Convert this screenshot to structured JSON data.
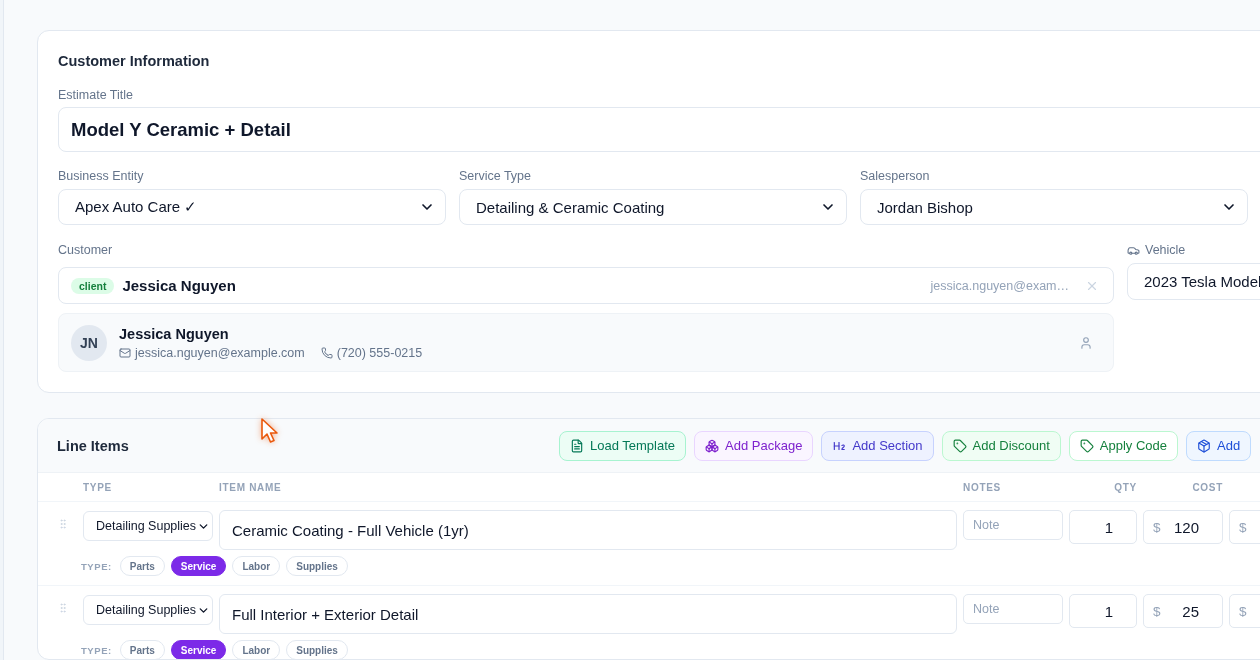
{
  "customer_information": {
    "title": "Customer Information",
    "estimate_title": {
      "label": "Estimate Title",
      "value": "Model Y Ceramic + Detail"
    },
    "selects": [
      {
        "label": "Business Entity",
        "value": "Apex Auto Care ✓"
      },
      {
        "label": "Service Type",
        "value": "Detailing & Ceramic Coating"
      },
      {
        "label": "Salesperson",
        "value": "Jordan Bishop"
      }
    ],
    "customer": {
      "label": "Customer",
      "badge": "client",
      "name": "Jessica Nguyen",
      "email": "jessica.nguyen@exam…"
    },
    "customer_card": {
      "initials": "JN",
      "name": "Jessica Nguyen",
      "email": "jessica.nguyen@example.com",
      "phone": "(720) 555-0215"
    },
    "vehicle": {
      "label": "Vehicle",
      "value": "2023 Tesla Model"
    }
  },
  "line_items": {
    "title": "Line Items",
    "buttons": [
      {
        "label": "Load Template",
        "kind": "template"
      },
      {
        "label": "Add Package",
        "kind": "package"
      },
      {
        "label": "Add Section",
        "kind": "section"
      },
      {
        "label": "Add Discount",
        "kind": "discount"
      },
      {
        "label": "Apply Code",
        "kind": "code"
      },
      {
        "label": "Add",
        "kind": "item"
      }
    ],
    "columns": [
      "TYPE",
      "ITEM NAME",
      "NOTES",
      "QTY",
      "COST"
    ],
    "rows": [
      {
        "category": "Detailing Supplies",
        "name": "Ceramic Coating - Full Vehicle (1yr)",
        "notes_placeholder": "Note",
        "qty": "1",
        "cost_currency": "$",
        "cost": "120",
        "column_6": {
          "currency": "$"
        },
        "type_label": "TYPE:",
        "types": [
          {
            "label": "Parts",
            "selected": false
          },
          {
            "label": "Service",
            "selected": true
          },
          {
            "label": "Labor",
            "selected": false
          },
          {
            "label": "Supplies",
            "selected": false
          }
        ]
      },
      {
        "category": "Detailing Supplies",
        "name": "Full Interior + Exterior Detail",
        "notes_placeholder": "Note",
        "qty": "1",
        "cost_currency": "$",
        "cost": "25",
        "column_6": {
          "currency": "$"
        },
        "type_label": "TYPE:",
        "types": [
          {
            "label": "Parts",
            "selected": false
          },
          {
            "label": "Service",
            "selected": true
          },
          {
            "label": "Labor",
            "selected": false
          },
          {
            "label": "Supplies",
            "selected": false
          }
        ]
      }
    ]
  }
}
